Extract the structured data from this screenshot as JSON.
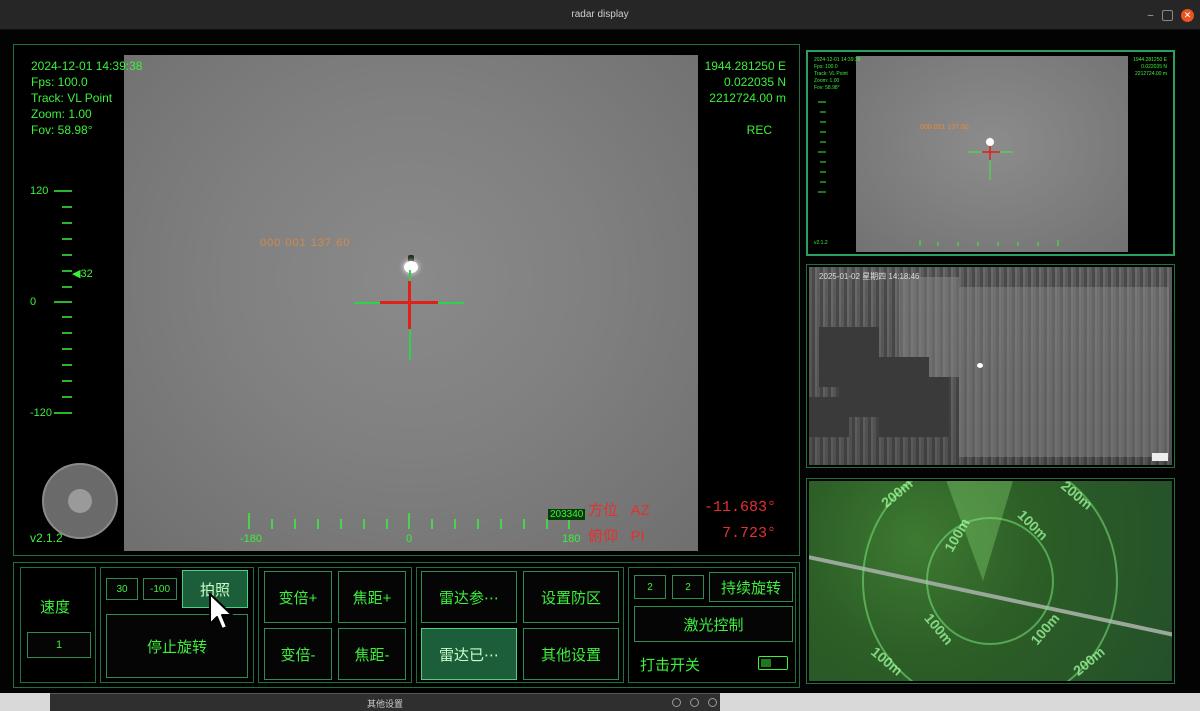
{
  "window": {
    "title": "radar display"
  },
  "main_view": {
    "osd_left": [
      "2024-12-01 14:39:38",
      "Fps: 100.0",
      "Track: VL Point",
      "Zoom: 1.00",
      "Fov: 58.98°"
    ],
    "osd_right": [
      "1944.281250 E",
      "0.022035 N",
      "2212724.00 m"
    ],
    "rec": "REC",
    "version": "v2.1.2",
    "pitch_scale": [
      "120",
      "0",
      "-120"
    ],
    "pitch_marker": "◀32",
    "az_scale": [
      "-180",
      "0",
      "180"
    ],
    "target_label": "000 001 137.60",
    "badge": "203340",
    "az_label": "方位",
    "az_code": "AZ",
    "az_value": "-11.683°",
    "pi_label": "俯仰",
    "pi_code": "PI",
    "pi_value": "7.723°"
  },
  "thumb": {
    "osd_left": [
      "2024-12-01 14:39:38",
      "Fps: 100.0",
      "Track: VL Point",
      "Zoom: 1.00",
      "Fov: 58.98°"
    ],
    "osd_right": [
      "1944.281250 E",
      "0.022035 N",
      "2212724.00 m"
    ],
    "label": "000 001 137.60",
    "version": "v2.1.2"
  },
  "radar_image": {
    "header": "2025-01-02 星期四 14:18:46"
  },
  "map": {
    "ring_labels": [
      "200m",
      "100m",
      "100m",
      "100m",
      "100m",
      "100m",
      "200m",
      "200m"
    ]
  },
  "controls": {
    "speed_label": "速度",
    "speed_value": "1",
    "val_30": "30",
    "val_neg100": "-100",
    "btn_photo": "拍照",
    "btn_stop_rotate": "停止旋转",
    "btn_zoom_in": "变倍+",
    "btn_zoom_out": "变倍-",
    "btn_focus_in": "焦距+",
    "btn_focus_out": "焦距-",
    "btn_radar_param": "雷达参⋯",
    "btn_radar_started": "雷达已⋯",
    "btn_set_zone": "设置防区",
    "btn_other_settings": "其他设置",
    "val_2a": "2",
    "val_2b": "2",
    "btn_continuous_rotate": "持续旋转",
    "btn_laser": "激光控制",
    "strike_label": "打击开关"
  },
  "taskbar": {
    "title": "其他设置"
  },
  "colors": {
    "osd_green": "#3cf03c",
    "alert_red": "#e53030",
    "accent_orange": "#e88a3a",
    "close_orange": "#e95420"
  }
}
